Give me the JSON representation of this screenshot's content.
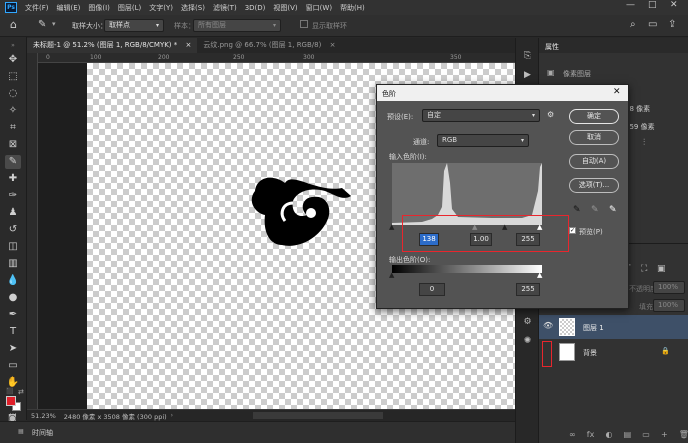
{
  "app": {
    "logo": "Ps"
  },
  "menu": [
    "文件(F)",
    "编辑(E)",
    "图像(I)",
    "图层(L)",
    "文字(Y)",
    "选择(S)",
    "滤镜(T)",
    "3D(D)",
    "视图(V)",
    "窗口(W)",
    "帮助(H)"
  ],
  "window_controls": {
    "minimize": "—",
    "maximize": "□",
    "close": "✕"
  },
  "options": {
    "sample_size_label": "取样大小：",
    "sample_size_value": "取样点",
    "sample_label": "样本：",
    "sample_value": "所有图层",
    "show_ring_label": "显示取样环"
  },
  "tabs": [
    {
      "label": "未标题-1 @ 51.2% (图层 1, RGB/8/CMYK) *",
      "close": "×"
    },
    {
      "label": "云纹.png @ 66.7% (图层 1, RGB/8)",
      "close": "×"
    }
  ],
  "ruler": {
    "labels": [
      "0",
      "100",
      "200",
      "250",
      "300",
      "350"
    ]
  },
  "status": {
    "zoom": "51.23%",
    "doc": "2480 像素 x 3508 像素 (300 ppi)"
  },
  "timeline": {
    "label": "时间轴"
  },
  "properties": {
    "tab": "属性",
    "subtitle": "像素图层",
    "w_value": "68 像素",
    "h_value": "359 像素"
  },
  "layers": {
    "opacity_label": "不透明度:",
    "opacity_value": "100%",
    "fill_label": "填充:",
    "fill_value": "100%",
    "items": [
      {
        "name": "图层 1",
        "selected": true
      },
      {
        "name": "背景",
        "selected": false
      }
    ],
    "lock_icon": "🔒",
    "bottom_icons": [
      "∞",
      "fx",
      "◐",
      "▤",
      "▭",
      "+",
      "🗑"
    ]
  },
  "dialog": {
    "title": "色阶",
    "close": "✕",
    "preset_label": "预设(E):",
    "preset_value": "自定",
    "channel_label": "通道:",
    "channel_value": "RGB",
    "input_label": "输入色阶(I):",
    "input_black": "138",
    "input_gamma": "1.00",
    "input_white": "255",
    "output_label": "输出色阶(O):",
    "output_black": "0",
    "output_white": "255",
    "buttons": {
      "ok": "确定",
      "cancel": "取消",
      "auto": "自动(A)",
      "options": "选项(T)..."
    },
    "preview_label": "预览(P)",
    "preview_checked": true
  },
  "colors": {
    "accent": "#31a8ff",
    "highlight_red": "#e8262d",
    "foreground_swatch": "#e0202a",
    "background_swatch": "#ffffff",
    "layer_selected": "#3e5068"
  }
}
